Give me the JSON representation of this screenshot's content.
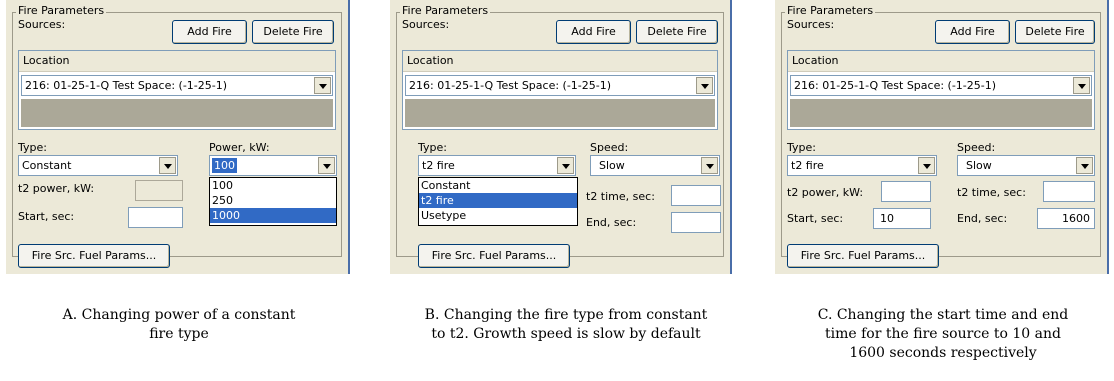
{
  "panels": [
    {
      "group_title": "Fire Parameters",
      "sources_label": "Sources:",
      "add_fire": "Add Fire",
      "delete_fire": "Delete Fire",
      "location_header": "Location",
      "location_value": "216: 01-25-1-Q Test Space: (-1-25-1)",
      "type_label": "Type:",
      "type_value": "Constant",
      "power_label": "Power, kW:",
      "power_value": "100",
      "power_options": [
        "100",
        "250",
        "1000"
      ],
      "t2_power_label": "t2 power, kW:",
      "start_label": "Start, sec:",
      "fuel_button": "Fire Src. Fuel Params...",
      "caption": [
        "A. Changing power of a constant",
        "fire type"
      ]
    },
    {
      "group_title": "Fire Parameters",
      "sources_label": "Sources:",
      "add_fire": "Add Fire",
      "delete_fire": "Delete Fire",
      "location_header": "Location",
      "location_value": "216: 01-25-1-Q Test Space: (-1-25-1)",
      "type_label": "Type:",
      "type_value": "t2 fire",
      "type_options": [
        "Constant",
        "t2 fire",
        "Usetype"
      ],
      "speed_label": "Speed:",
      "speed_value": "Slow",
      "t2_time_label": "t2 time, sec:",
      "end_label": "End, sec:",
      "fuel_button": "Fire Src. Fuel Params...",
      "caption": [
        "B. Changing the fire type from constant",
        "to t2. Growth speed is slow by default"
      ]
    },
    {
      "group_title": "Fire Parameters",
      "sources_label": "Sources:",
      "add_fire": "Add Fire",
      "delete_fire": "Delete Fire",
      "location_header": "Location",
      "location_value": "216: 01-25-1-Q Test Space: (-1-25-1)",
      "type_label": "Type:",
      "type_value": "t2 fire",
      "speed_label": "Speed:",
      "speed_value": "Slow",
      "t2_power_label": "t2 power, kW:",
      "t2_time_label": "t2 time, sec:",
      "start_label": "Start, sec:",
      "start_value": "10",
      "end_label": "End, sec:",
      "end_value": "1600",
      "fuel_button": "Fire Src. Fuel Params...",
      "caption": [
        "C. Changing the start time and end",
        "time for the fire source to 10 and",
        "1600 seconds respectively"
      ]
    }
  ]
}
